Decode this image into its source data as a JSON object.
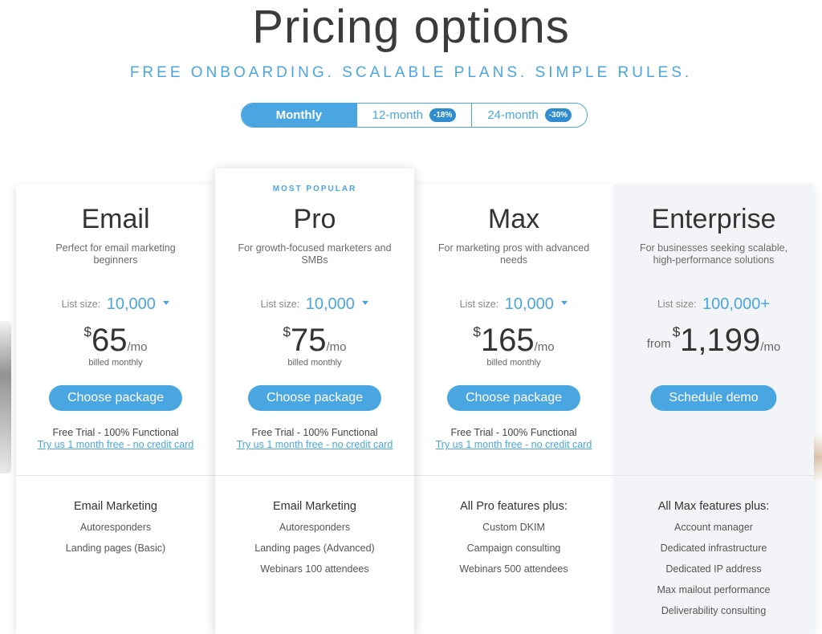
{
  "header": {
    "title": "Pricing options",
    "subtitle": "FREE ONBOARDING. SCALABLE PLANS. SIMPLE RULES."
  },
  "billing_toggle": {
    "options": [
      {
        "label": "Monthly",
        "badge": "",
        "active": true
      },
      {
        "label": "12-month",
        "badge": "-18%",
        "active": false
      },
      {
        "label": "24-month",
        "badge": "-30%",
        "active": false
      }
    ]
  },
  "colors": {
    "accent": "#4aa6e0",
    "badge": "#2f8ccf",
    "enterprise_bg": "#f2f4f7"
  },
  "plans": [
    {
      "name": "Email",
      "description": "Perfect for email marketing beginners",
      "list_size_label": "List size:",
      "list_size": "10,000",
      "currency": "$",
      "price": "65",
      "per": "/mo",
      "billing_note": "billed monthly",
      "cta": "Choose package",
      "trial_line": "Free Trial - 100% Functional",
      "trial_link": "Try us 1 month free - no credit card",
      "features": [
        "Email Marketing",
        "Autoresponders",
        "Landing pages (Basic)"
      ]
    },
    {
      "badge": "MOST POPULAR",
      "name": "Pro",
      "description": "For growth-focused marketers and SMBs",
      "list_size_label": "List size:",
      "list_size": "10,000",
      "currency": "$",
      "price": "75",
      "per": "/mo",
      "billing_note": "billed monthly",
      "cta": "Choose package",
      "trial_line": "Free Trial - 100% Functional",
      "trial_link": "Try us 1 month free - no credit card",
      "features": [
        "Email Marketing",
        "Autoresponders",
        "Landing pages (Advanced)",
        "Webinars 100 attendees"
      ]
    },
    {
      "name": "Max",
      "description": "For marketing pros with advanced needs",
      "list_size_label": "List size:",
      "list_size": "10,000",
      "currency": "$",
      "price": "165",
      "per": "/mo",
      "billing_note": "billed monthly",
      "cta": "Choose package",
      "trial_line": "Free Trial - 100% Functional",
      "trial_link": "Try us 1 month free - no credit card",
      "features": [
        "All Pro features plus:",
        "Custom DKIM",
        "Campaign consulting",
        "Webinars 500 attendees"
      ]
    },
    {
      "name": "Enterprise",
      "description": "For businesses seeking scalable, high-performance solutions",
      "list_size_label": "List size:",
      "list_size": "100,000+",
      "price_prefix": "from",
      "currency": "$",
      "price": "1,199",
      "per": "/mo",
      "cta": "Schedule demo",
      "features": [
        "All Max features plus:",
        "Account manager",
        "Dedicated infrastructure",
        "Dedicated IP address",
        "Max mailout performance",
        "Deliverability consulting"
      ]
    }
  ]
}
